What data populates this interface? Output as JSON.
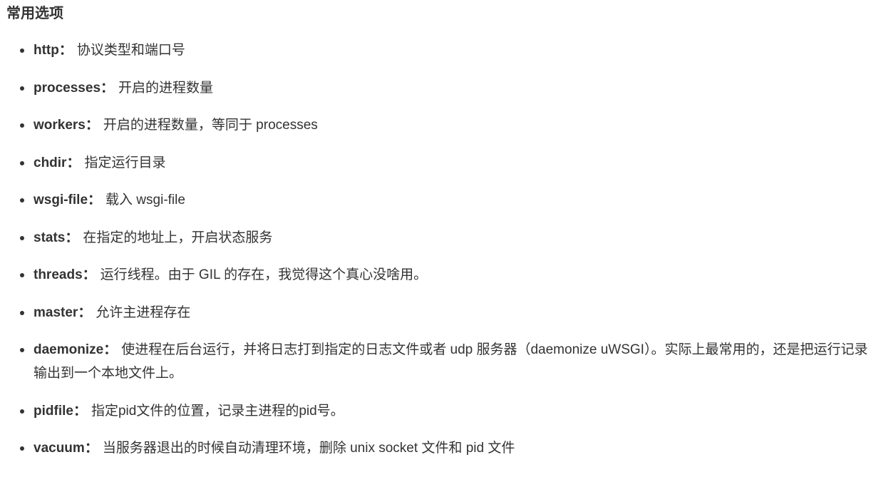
{
  "section": {
    "heading": "常用选项"
  },
  "options": [
    {
      "name": "http",
      "colon": "：",
      "desc": "协议类型和端口号"
    },
    {
      "name": "processes",
      "colon": "：",
      "desc": "开启的进程数量"
    },
    {
      "name": "workers",
      "colon": "：",
      "desc": "开启的进程数量，等同于 processes"
    },
    {
      "name": "chdir",
      "colon": "：",
      "desc": "指定运行目录"
    },
    {
      "name": "wsgi-file",
      "colon": "：",
      "desc": "载入 wsgi-file"
    },
    {
      "name": "stats",
      "colon": "：",
      "desc": "在指定的地址上，开启状态服务"
    },
    {
      "name": "threads",
      "colon": "：",
      "desc": "运行线程。由于 GIL 的存在，我觉得这个真心没啥用。"
    },
    {
      "name": "master",
      "colon": "：",
      "desc": "允许主进程存在"
    },
    {
      "name": "daemonize",
      "colon": "：",
      "desc": "使进程在后台运行，并将日志打到指定的日志文件或者 udp 服务器（daemonize uWSGI）。实际上最常用的，还是把运行记录输出到一个本地文件上。"
    },
    {
      "name": "pidfile",
      "colon": "：",
      "desc": "指定pid文件的位置，记录主进程的pid号。"
    },
    {
      "name": "vacuum",
      "colon": "：",
      "desc": "当服务器退出的时候自动清理环境，删除 unix socket 文件和 pid 文件"
    }
  ]
}
